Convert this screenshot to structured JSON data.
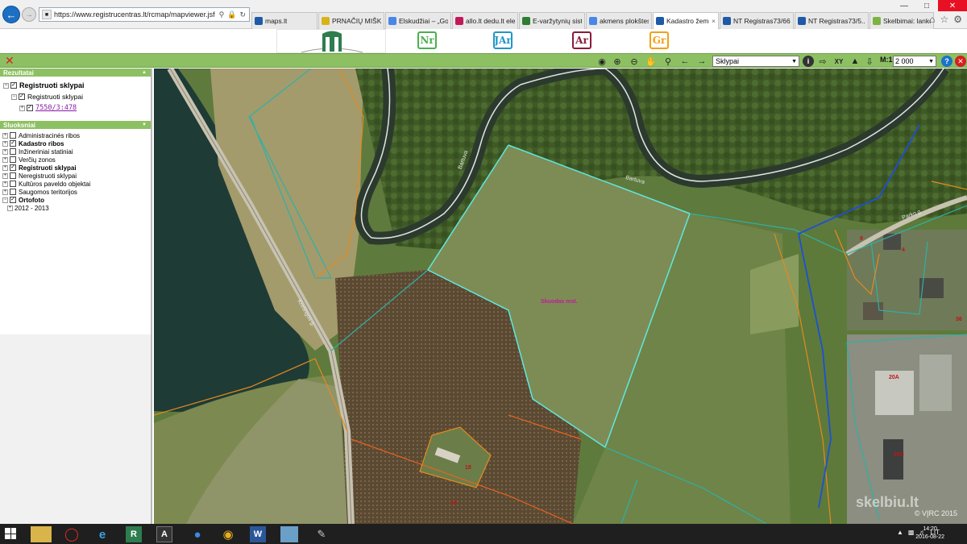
{
  "browser": {
    "url": "https://www.registrucentras.lt/rcmap/mapviewer.jsf",
    "tabs": [
      {
        "label": "maps.lt",
        "icon_color": "#1e5aa8"
      },
      {
        "label": "PRNAČIŲ MIŠKO ...",
        "icon_color": "#d8b31a"
      },
      {
        "label": "Elskudžiai – „Goo...",
        "icon_color": "#4a86e8"
      },
      {
        "label": "allo.lt dedu.lt elen...",
        "icon_color": "#c2185b"
      },
      {
        "label": "E-varžytynių siste...",
        "icon_color": "#2e7d32"
      },
      {
        "label": "akmens plokštes ...",
        "icon_color": "#4a86e8"
      },
      {
        "label": "Kadastro žeme...",
        "icon_color": "#1e5aa8",
        "active": true
      },
      {
        "label": "NT Registras73/662",
        "icon_color": "#1e5aa8"
      },
      {
        "label": "NT Registras73/5...",
        "icon_color": "#1e5aa8"
      },
      {
        "label": "Skelbimai: lanko...",
        "icon_color": "#7cb342"
      }
    ]
  },
  "header": {
    "logos": [
      {
        "text": "Nr",
        "color": "#4caf50"
      },
      {
        "text": "JAr",
        "color": "#2196c9"
      },
      {
        "text": "Ar",
        "color": "#8b1a3e"
      },
      {
        "text": "Gr",
        "color": "#f0a018"
      }
    ]
  },
  "toolbar": {
    "layer_value": "Sklypai",
    "scale_label": "M:1",
    "scale_value": "2 000",
    "icons": [
      "binoculars-icon",
      "zoom-in-icon",
      "zoom-out-icon",
      "pan-hand-icon",
      "zoom-extent-icon",
      "back-arrow-icon",
      "forward-arrow-icon"
    ]
  },
  "panel": {
    "results_title": "Rezultatai",
    "results": {
      "root_label": "Registruoti sklypai",
      "child_label": "Registruoti sklypai",
      "parcel_link": "7550/3:478"
    },
    "layers_title": "Sluoksniai",
    "layers": [
      {
        "label": "Administracinės ribos",
        "checked": false,
        "bold": false
      },
      {
        "label": "Kadastro ribos",
        "checked": true,
        "bold": true
      },
      {
        "label": "Inžineriniai statiniai",
        "checked": false,
        "bold": false
      },
      {
        "label": "Verčių zonos",
        "checked": false,
        "bold": false
      },
      {
        "label": "Registruoti sklypai",
        "checked": true,
        "bold": true
      },
      {
        "label": "Neregistruoti sklypai",
        "checked": false,
        "bold": false
      },
      {
        "label": "Kultūros paveldo objektai",
        "checked": false,
        "bold": false
      },
      {
        "label": "Saugomos teritorijos",
        "checked": false,
        "bold": false
      },
      {
        "label": "Ortofoto",
        "checked": true,
        "bold": true
      }
    ],
    "ortofoto_child": "2012 - 2013"
  },
  "map": {
    "parcel_label": "Skuodas mst.",
    "number_labels": [
      "20A",
      "20C",
      "18",
      "16",
      "36",
      "9",
      "4"
    ],
    "street_labels": [
      "Bartuva",
      "Bartuva",
      "Kretingos g.",
      "Parko g."
    ],
    "copyright": "© VĮRC 2015",
    "watermark": "skelbiu.lt"
  },
  "taskbar": {
    "clock_time": "14:20",
    "clock_date": "2016-08-22",
    "language": "LIT"
  }
}
